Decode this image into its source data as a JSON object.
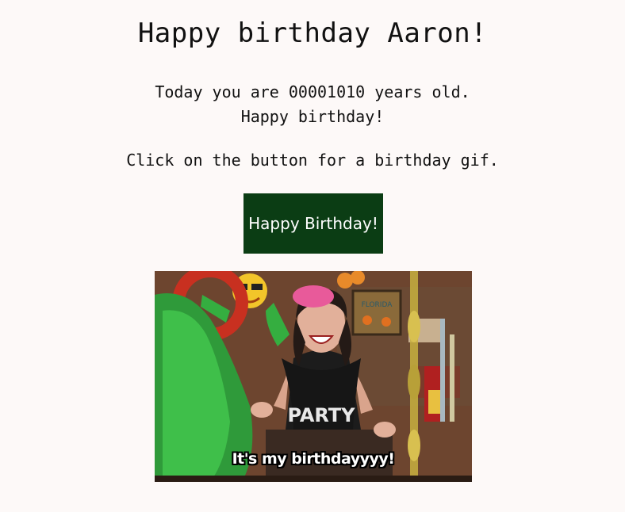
{
  "heading": "Happy birthday Aaron!",
  "age_line": "Today you are 00001010 years old.",
  "greeting_line": "Happy birthday!",
  "instruction": "Click on the button for a birthday gif.",
  "button_label": "Happy Birthday!",
  "gif": {
    "caption": "It's my birthdayyyy!",
    "sign_text": "FLORIDA",
    "shirt_text": "PARTY"
  },
  "colors": {
    "background": "#fdf9f8",
    "button_bg": "#0b3d14",
    "button_text": "#ffffff"
  }
}
